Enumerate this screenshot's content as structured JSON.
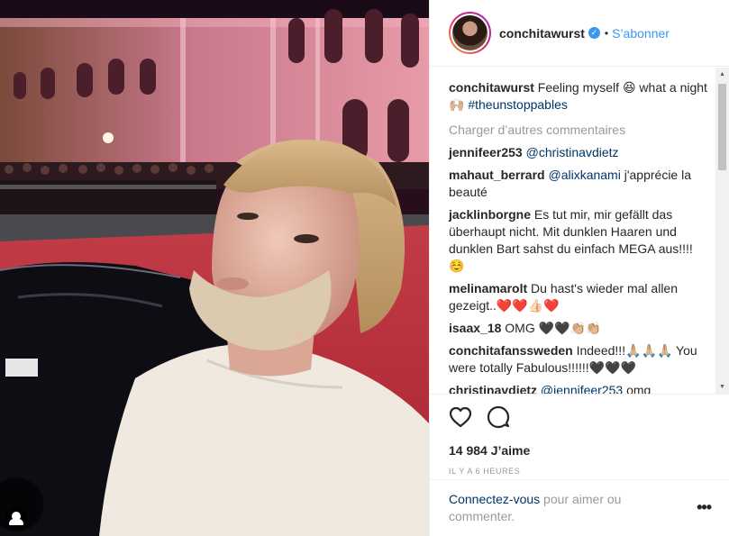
{
  "post": {
    "username": "conchitawurst",
    "follow_label": "S’abonner",
    "dot": "•",
    "verified_icon": "verified-check-icon"
  },
  "caption": {
    "username": "conchitawurst",
    "text_start": " Feeling myself 😆 what a night 🙌🏼 ",
    "hashtag": "#theunstoppables"
  },
  "load_more_label": "Charger d’autres commentaires",
  "comments": [
    {
      "user": "jennifeer253",
      "mention": "@christinavdietz",
      "text": ""
    },
    {
      "user": "mahaut_berrard",
      "mention": "@alixkanami",
      "text": " j'apprécie la beauté"
    },
    {
      "user": "jacklinborgne",
      "mention": "",
      "text": " Es tut mir, mir gefällt das überhaupt nicht. Mit dunklen Haaren und dunklen Bart sahst du einfach MEGA aus!!!! ☺️"
    },
    {
      "user": "melinamarolt",
      "mention": "",
      "text": " Du hast's wieder mal allen gezeigt..❤️❤️👍🏻❤️"
    },
    {
      "user": "isaax_18",
      "mention": "",
      "text": " OMG 🖤🖤👏🏼👏🏼"
    },
    {
      "user": "conchitafanssweden",
      "mention": "",
      "text": " Indeed!!!🙏🏼🙏🏼🙏🏼 You were totally Fabulous!!!!!!🖤🖤🖤"
    },
    {
      "user": "christinavdietz",
      "mention": "@jennifeer253",
      "text": " omg"
    }
  ],
  "likes_label": "14 984 J’aime",
  "time_label": "IL Y A 6 HEURES",
  "login": {
    "link": "Connectez-vous",
    "text": " pour aimer ou commenter."
  },
  "more_label": "•••",
  "colors": {
    "link": "#003569",
    "accent": "#3897f0",
    "muted": "#999999"
  }
}
